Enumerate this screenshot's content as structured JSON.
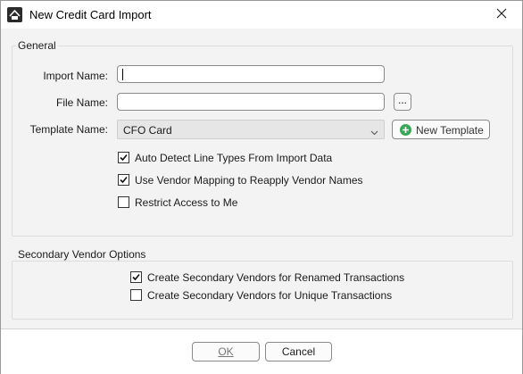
{
  "window": {
    "title": "New Credit Card Import",
    "app_icon": "cfo-app-icon",
    "close_glyph": "✕"
  },
  "general": {
    "legend": "General",
    "import_name_label": "Import Name:",
    "import_name_value": "",
    "file_name_label": "File Name:",
    "file_name_value": "",
    "browse_label": "...",
    "template_name_label": "Template Name:",
    "template_selected": "CFO Card",
    "new_template_label": "New Template",
    "options": [
      {
        "label": "Auto Detect Line Types From Import Data",
        "checked": true
      },
      {
        "label": "Use Vendor Mapping to Reapply Vendor Names",
        "checked": true
      },
      {
        "label": "Restrict Access to Me",
        "checked": false
      }
    ]
  },
  "secondary": {
    "legend": "Secondary Vendor Options",
    "options": [
      {
        "label": "Create Secondary Vendors for Renamed Transactions",
        "checked": true
      },
      {
        "label": "Create Secondary Vendors for Unique Transactions",
        "checked": false
      }
    ]
  },
  "footer": {
    "ok_label": "OK",
    "cancel_label": "Cancel"
  },
  "colors": {
    "accent_green": "#3aa757",
    "disabled_text": "#777777"
  }
}
